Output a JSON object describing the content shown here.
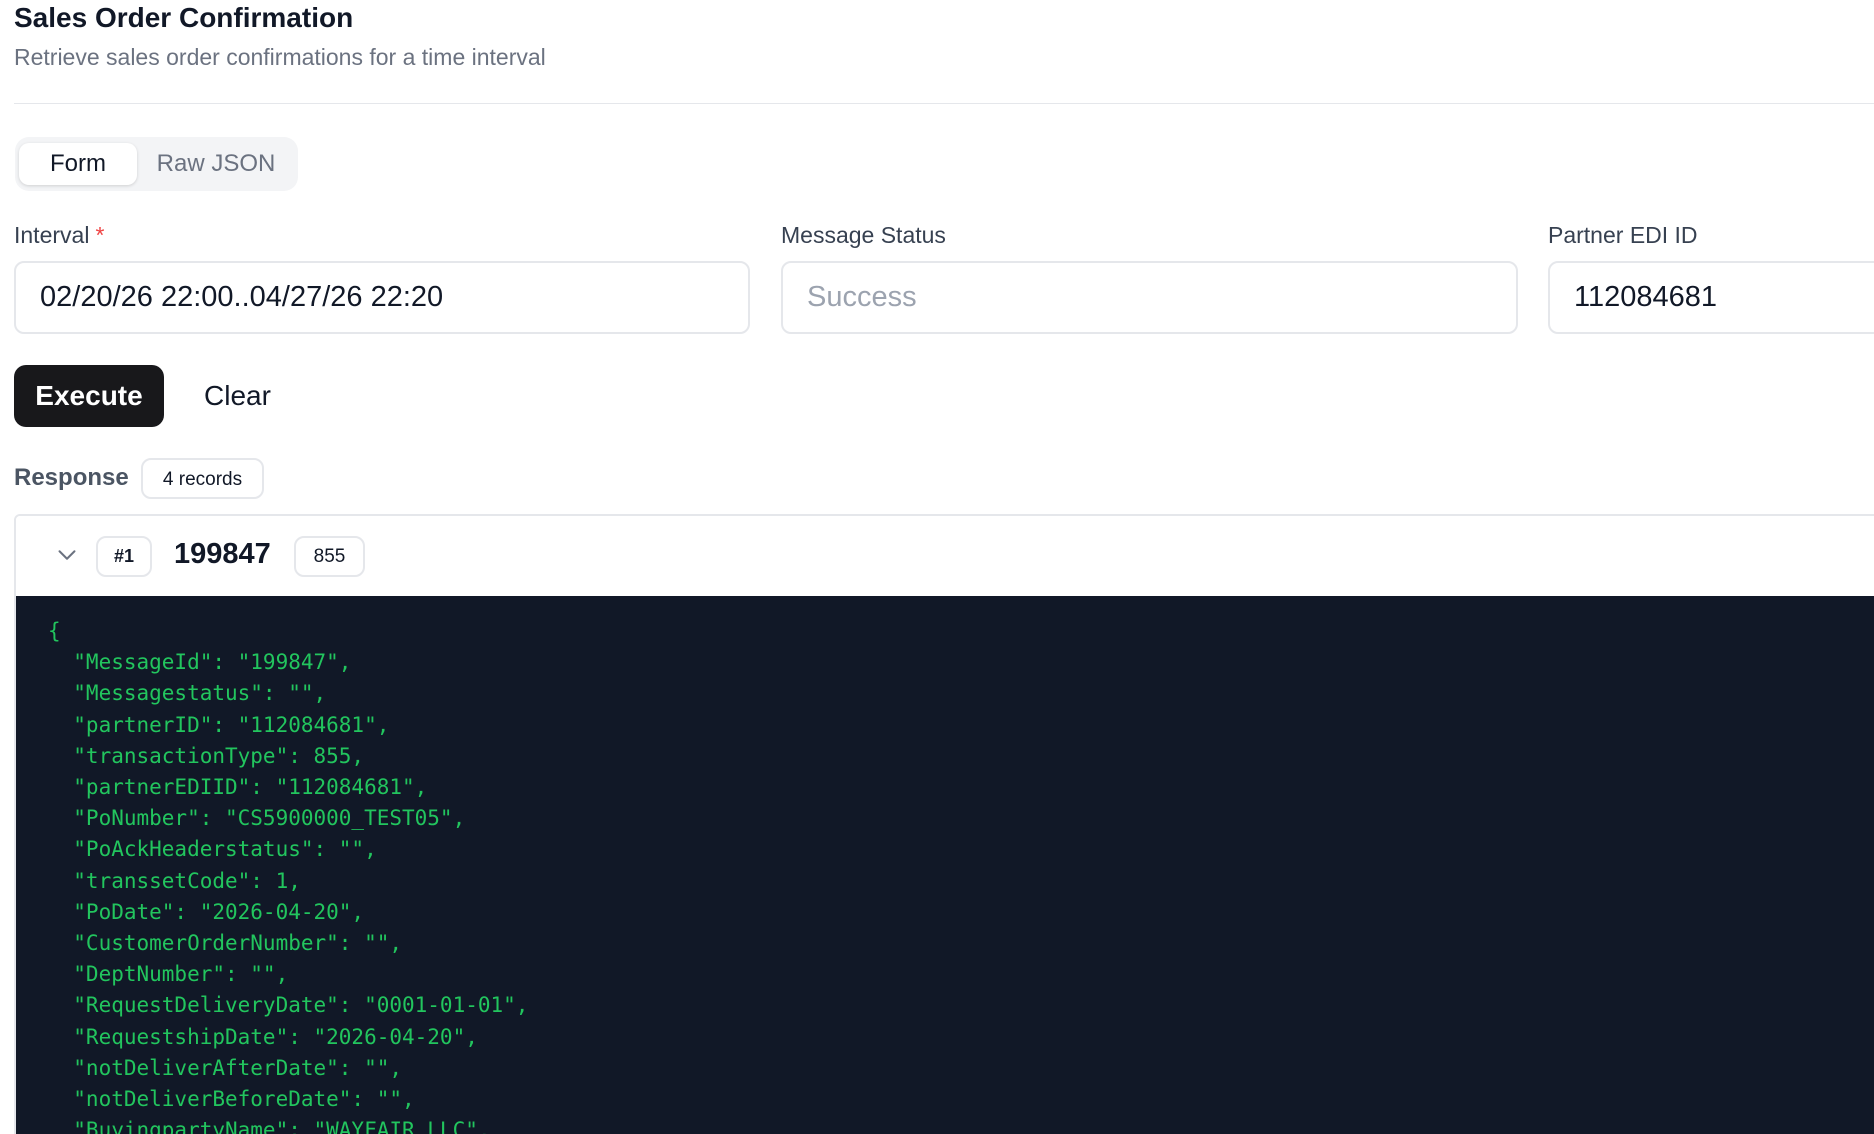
{
  "header": {
    "title": "Sales Order Confirmation",
    "subtitle": "Retrieve sales order confirmations for a time interval"
  },
  "tabs": [
    {
      "label": "Form",
      "active": true
    },
    {
      "label": "Raw JSON",
      "active": false
    }
  ],
  "form": {
    "interval": {
      "label": "Interval",
      "required_mark": "*",
      "value": "02/20/26 22:00..04/27/26 22:20"
    },
    "message_status": {
      "label": "Message Status",
      "placeholder": "Success",
      "value": ""
    },
    "partner_edi_id": {
      "label": "Partner EDI ID",
      "value": "112084681"
    }
  },
  "actions": {
    "execute_label": "Execute",
    "clear_label": "Clear"
  },
  "response": {
    "label": "Response",
    "records_badge": "4 records",
    "records": [
      {
        "index": "#1",
        "message_id": "199847",
        "transaction_type": "855",
        "json_lines": [
          "{",
          "  \"MessageId\": \"199847\",",
          "  \"Messagestatus\": \"\",",
          "  \"partnerID\": \"112084681\",",
          "  \"transactionType\": 855,",
          "  \"partnerEDIID\": \"112084681\",",
          "  \"PoNumber\": \"CS5900000_TEST05\",",
          "  \"PoAckHeaderstatus\": \"\",",
          "  \"transsetCode\": 1,",
          "  \"PoDate\": \"2026-04-20\",",
          "  \"CustomerOrderNumber\": \"\",",
          "  \"DeptNumber\": \"\",",
          "  \"RequestDeliveryDate\": \"0001-01-01\",",
          "  \"RequestshipDate\": \"2026-04-20\",",
          "  \"notDeliverAfterDate\": \"\",",
          "  \"notDeliverBeforeDate\": \"\",",
          "  \"BuyingpartyName\": \"WAYFAIR LLC\","
        ]
      }
    ]
  },
  "colors": {
    "execute_bg": "#18181b",
    "code_bg": "#111827",
    "code_text": "#22c55e",
    "required": "#ef4444"
  },
  "icons": {
    "record_toggle": "chevron-down-icon"
  }
}
